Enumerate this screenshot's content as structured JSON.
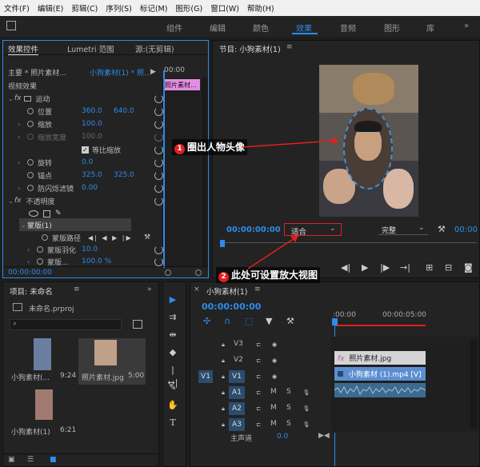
{
  "menu": [
    "文件(F)",
    "编辑(E)",
    "剪辑(C)",
    "序列(S)",
    "标记(M)",
    "图形(G)",
    "窗口(W)",
    "帮助(H)"
  ],
  "workspaces": [
    "组件",
    "编辑",
    "颜色",
    "效果",
    "音频",
    "图形",
    "库"
  ],
  "workspace_menu_icon": "menu-icon",
  "effect_panel": {
    "tabs": [
      "效果控件",
      "Lumetri 范围",
      "源:(无剪辑)"
    ],
    "master_label": "主要 * 照片素材...",
    "sequence_clip": "小狗素材(1) * 照...",
    "timecode_top": "00:00",
    "clip_label": "照片素材...",
    "section": "视频效果",
    "motion": "运动",
    "position_label": "位置",
    "position_x": "360.0",
    "position_y": "640.0",
    "scale_label": "缩放",
    "scale_value": "100.0",
    "scale_width_label": "缩放宽度",
    "scale_width_value": "100.0",
    "uniform_scale": "等比缩放",
    "rotation_label": "旋转",
    "rotation_value": "0.0",
    "anchor_label": "锚点",
    "anchor_x": "325.0",
    "anchor_y": "325.0",
    "flicker_label": "防闪烁滤镜",
    "flicker_value": "0.00",
    "opacity": "不透明度",
    "mask": "蒙版(1)",
    "mask_path": "蒙版路径",
    "mask_feather": "蒙版羽化",
    "mask_feather_value": "10.0",
    "mask_opacity": "蒙版...",
    "mask_opacity_value": "100.0 %",
    "timecode": "00:00:00:00"
  },
  "program": {
    "title": "节目: 小狗素材(1)",
    "timecode": "00:00:00:00",
    "zoom_value": "适合",
    "quality_value": "完整",
    "end_timecode": "00:00"
  },
  "project": {
    "title": "项目: 未命名",
    "file": "未命名.prproj",
    "items": [
      {
        "name": "小狗素材(...",
        "duration": "9:24"
      },
      {
        "name": "照片素材.jpg",
        "duration": "5:00"
      },
      {
        "name": "小狗素材(1)",
        "duration": "6:21"
      }
    ]
  },
  "timeline": {
    "title": "小狗素材(1)",
    "timecode": "00:00:00:00",
    "ruler": [
      ":00:00",
      "00:00:05:00"
    ],
    "tracks": [
      {
        "name": "V3",
        "source": ""
      },
      {
        "name": "V2",
        "source": ""
      },
      {
        "name": "V1",
        "source": "V1"
      },
      {
        "name": "A1",
        "source": "A1"
      },
      {
        "name": "A2",
        "source": ""
      },
      {
        "name": "A3",
        "source": ""
      }
    ],
    "track_letters": [
      "M",
      "S"
    ],
    "master_label": "主声道",
    "master_value": "0.0",
    "clip_v2": "照片素材.jpg",
    "clip_v1": "小狗素材 (1).mp4 [V]"
  },
  "callouts": {
    "one_num": "1",
    "one": "圈出人物头像",
    "two_num": "2",
    "two": "此处可设置放大视图"
  },
  "colors": {
    "accent": "#2d8ceb",
    "annotation": "#e02020",
    "clip_pink": "#e38de3",
    "clip_video": "#5c8fd1"
  }
}
